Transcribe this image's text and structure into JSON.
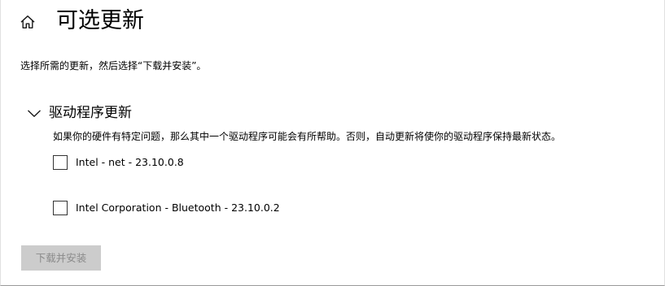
{
  "header": {
    "home_icon": "home-icon",
    "title": "可选更新"
  },
  "description": "选择所需的更新，然后选择“下载并安装”。",
  "driver_group": {
    "expanded": true,
    "chevron_icon": "chevron-down-icon",
    "title": "驱动程序更新",
    "description": "如果你的硬件有特定问题，那么其中一个驱动程序可能会有所帮助。否则，自动更新将使你的驱动程序保持最新状态。",
    "items": [
      {
        "label": "Intel - net - 23.10.0.8",
        "checked": false
      },
      {
        "label": "Intel Corporation - Bluetooth - 23.10.0.2",
        "checked": false
      }
    ]
  },
  "actions": {
    "install_label": "下载并安装",
    "install_enabled": false
  },
  "colors": {
    "background": "#ffffff",
    "text": "#000000",
    "disabled_button_bg": "#cccccc",
    "disabled_button_text": "#8a8a8a"
  }
}
